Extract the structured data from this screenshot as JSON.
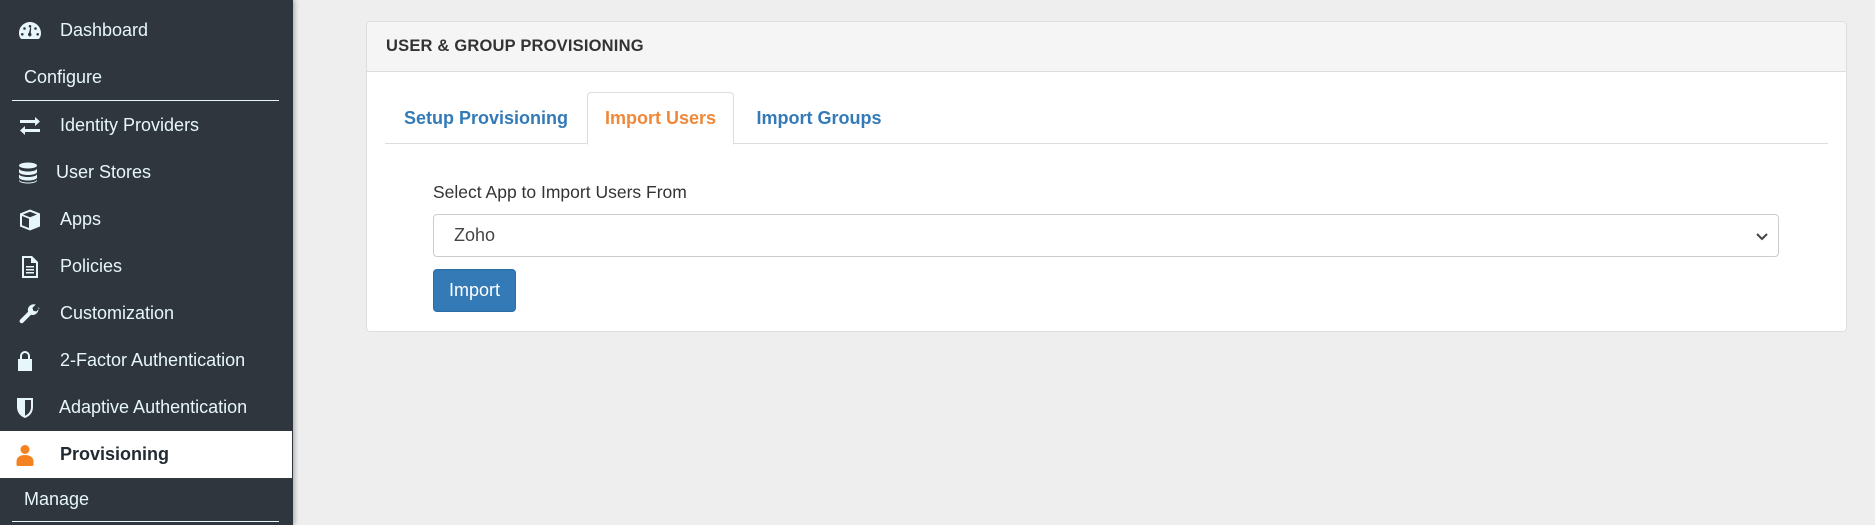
{
  "sidebar": {
    "items": [
      {
        "label": "Dashboard",
        "icon": "dashboard-icon"
      },
      {
        "label": "Identity Providers",
        "icon": "exchange-arrows-icon"
      },
      {
        "label": "User Stores",
        "icon": "database-icon"
      },
      {
        "label": "Apps",
        "icon": "cube-icon"
      },
      {
        "label": "Policies",
        "icon": "document-icon"
      },
      {
        "label": "Customization",
        "icon": "wrench-icon"
      },
      {
        "label": "2-Factor Authentication",
        "icon": "lock-icon"
      },
      {
        "label": "Adaptive Authentication",
        "icon": "shield-icon"
      },
      {
        "label": "Provisioning",
        "icon": "user-icon",
        "active": true
      }
    ],
    "sections": {
      "configure": "Configure",
      "manage": "Manage"
    }
  },
  "panel": {
    "title": "USER & GROUP PROVISIONING",
    "tabs": [
      {
        "label": "Setup Provisioning"
      },
      {
        "label": "Import Users",
        "active": true
      },
      {
        "label": "Import Groups"
      }
    ],
    "form": {
      "label": "Select App to Import Users From",
      "selected_app": "Zoho",
      "import_button": "Import"
    }
  },
  "colors": {
    "sidebar_bg": "#2f363d",
    "active_tab": "#f0883a",
    "link": "#337ab7",
    "accent_icon": "#f58220"
  }
}
